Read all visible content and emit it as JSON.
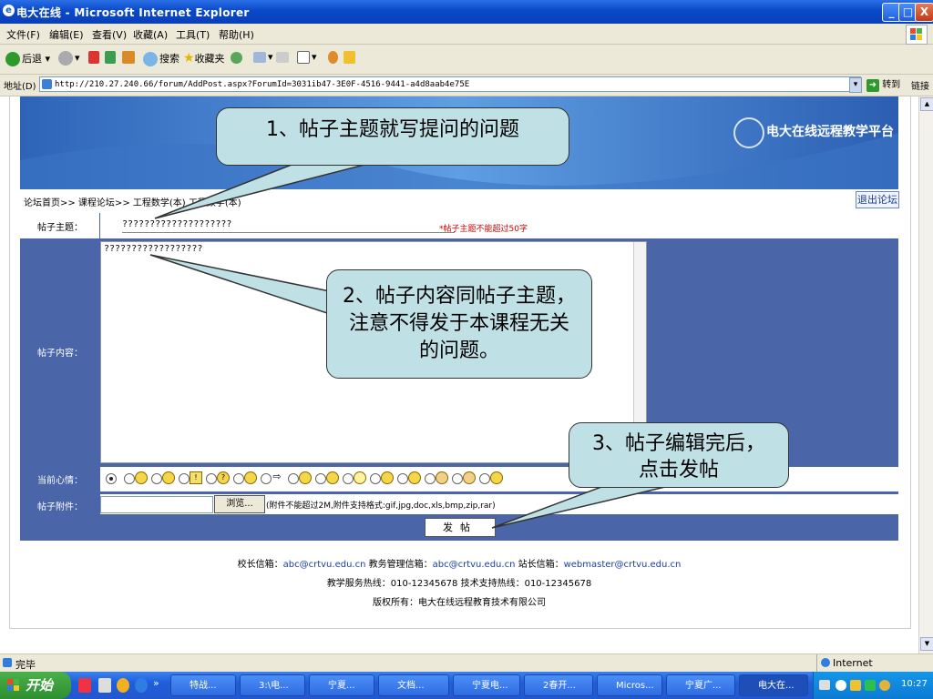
{
  "window": {
    "title": "电大在线 - Microsoft Internet Explorer",
    "min": "_",
    "max": "□",
    "close": "X"
  },
  "menu": [
    "文件(F)",
    "编辑(E)",
    "查看(V)",
    "收藏(A)",
    "工具(T)",
    "帮助(H)"
  ],
  "toolbar": {
    "back": "后退",
    "search": "搜索",
    "favorites": "收藏夹"
  },
  "address": {
    "label": "地址(D)",
    "url": "http://210.27.240.66/forum/AddPost.aspx?ForumId=3031ib47-3E0F-4516-9441-a4d8aab4e75E",
    "go": "转到",
    "links": "链接"
  },
  "banner": {
    "logo": "电大在线远程教学平台"
  },
  "breadcrumb": "论坛首页>> 课程论坛>> 工程数学(本) 工程数学(本)",
  "logout": "退出论坛",
  "form": {
    "subject_label": "帖子主题：",
    "subject_value": "????????????????????",
    "subject_note": "*帖子主题不能超过50字",
    "content_label": "帖子内容：",
    "content_value": "??????????????????",
    "mood_label": "当前心情：",
    "attach_label": "帖子附件：",
    "browse": "浏览...",
    "attach_note": "(附件不能超过2M,附件支持格式:gif,jpg,doc,xls,bmp,zip,rar)",
    "submit": "发帖"
  },
  "footer": {
    "l1a": "校长信箱：",
    "l1b": "abc@crtvu.edu.cn",
    "l1c": " 教务管理信箱：",
    "l1d": "abc@crtvu.edu.cn",
    "l1e": " 站长信箱：",
    "l1f": "webmaster@crtvu.edu.cn",
    "l2": "教学服务热线：010-12345678 技术支持热线：010-12345678",
    "l3": "版权所有：电大在线远程教育技术有限公司"
  },
  "callouts": {
    "c1": "1、帖子主题就写提问的问题",
    "c2": "2、帖子内容同帖子主题，注意不得发于本课程无关的问题。",
    "c3": "3、帖子编辑完后，点击发帖"
  },
  "status": {
    "left": "完毕",
    "right": "Internet"
  },
  "taskbar": {
    "start": "开始",
    "items": [
      "特战...",
      "3:\\电...",
      "宁夏...",
      "文档...",
      "宁夏电...",
      "2春开...",
      "Micros...",
      "宁夏广...",
      "电大在..."
    ],
    "clock": "10:27"
  }
}
